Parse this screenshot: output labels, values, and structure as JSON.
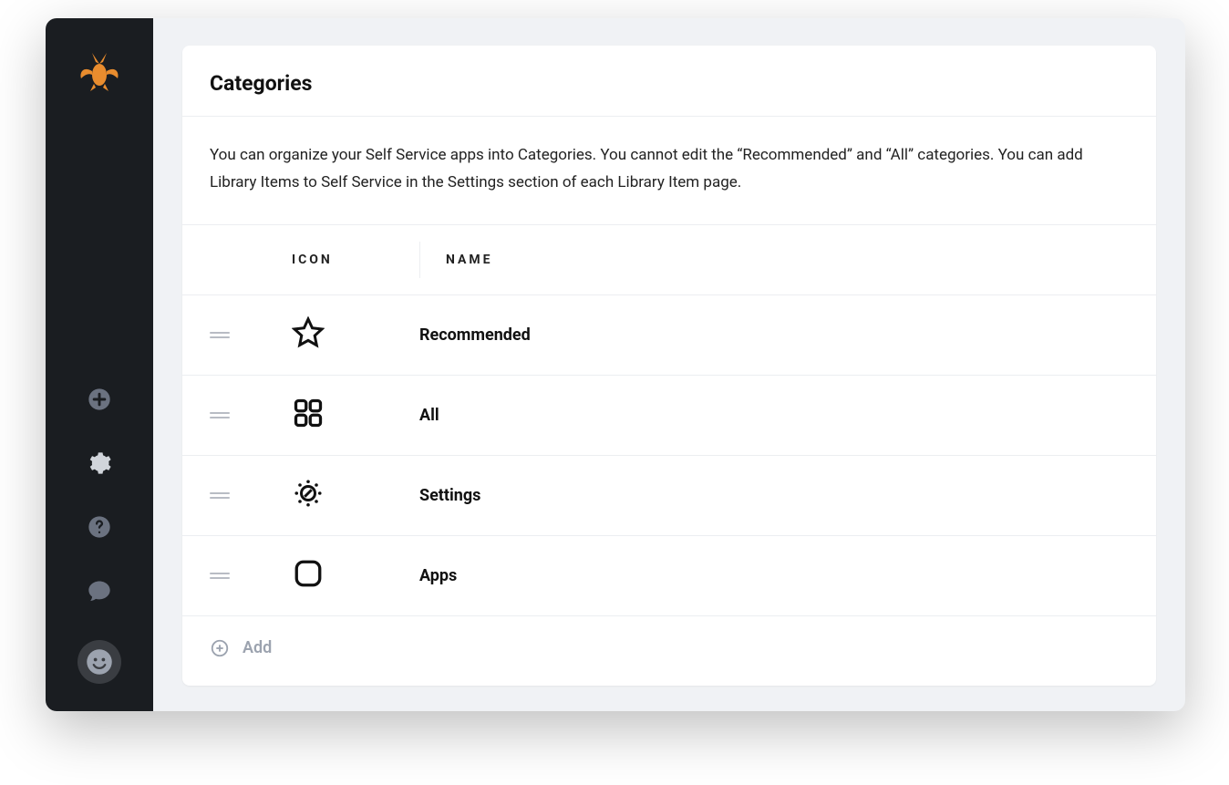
{
  "page": {
    "title": "Categories",
    "description": "You can organize your Self Service apps into Categories. You cannot edit the “Recommended” and “All” categories. You can add Library Items to Self Service in the Settings section of each Library Item page."
  },
  "table": {
    "headers": {
      "icon": "ICON",
      "name": "NAME"
    },
    "rows": [
      {
        "icon": "star-icon",
        "name": "Recommended"
      },
      {
        "icon": "grid-icon",
        "name": "All"
      },
      {
        "icon": "settings-dots-icon",
        "name": "Settings"
      },
      {
        "icon": "rounded-square-icon",
        "name": "Apps"
      }
    ],
    "add_label": "Add"
  },
  "sidebar": {
    "logo": "bee-logo",
    "items": [
      {
        "icon": "plus-circle-icon"
      },
      {
        "icon": "gear-icon"
      },
      {
        "icon": "help-icon"
      },
      {
        "icon": "chat-icon"
      },
      {
        "icon": "smiley-avatar"
      }
    ]
  }
}
